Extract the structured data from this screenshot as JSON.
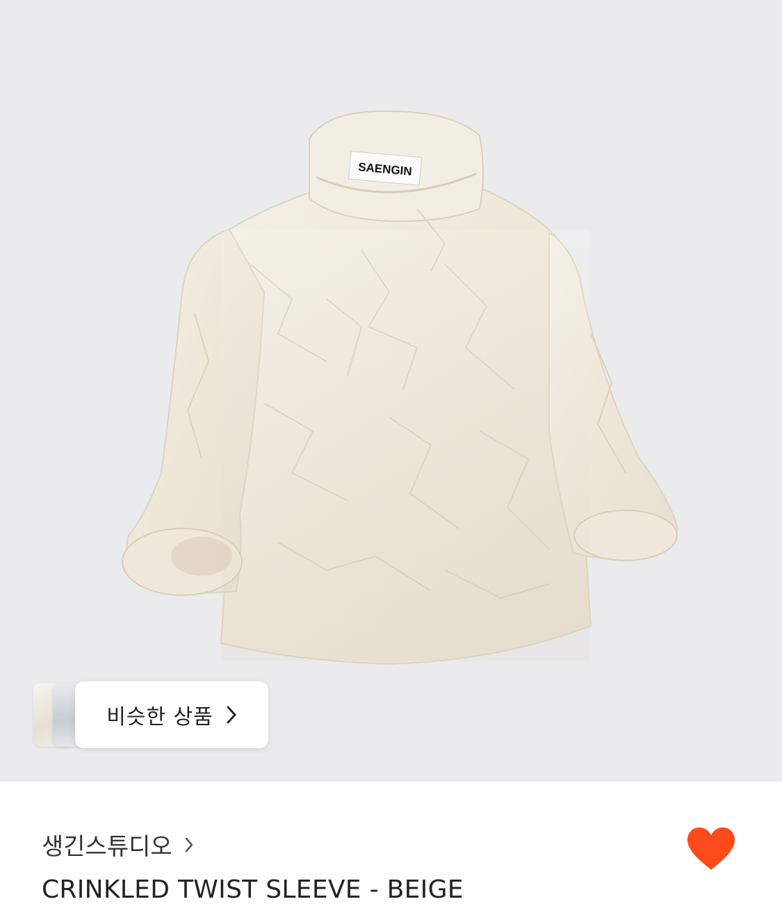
{
  "product_image": {
    "label_text": "SAENGIN",
    "background_color": "#ebebed",
    "garment_color": "#f1ebdd"
  },
  "similar_products": {
    "label": "비슷한 상품",
    "chevron_icon": "chevron-right-icon"
  },
  "product_info": {
    "brand": "생긴스튜디오",
    "brand_chevron_icon": "chevron-right-icon",
    "title": "CRINKLED TWIST SLEEVE - BEIGE",
    "like_icon": "heart-icon",
    "like_color": "#ff4a1c",
    "liked": true
  }
}
